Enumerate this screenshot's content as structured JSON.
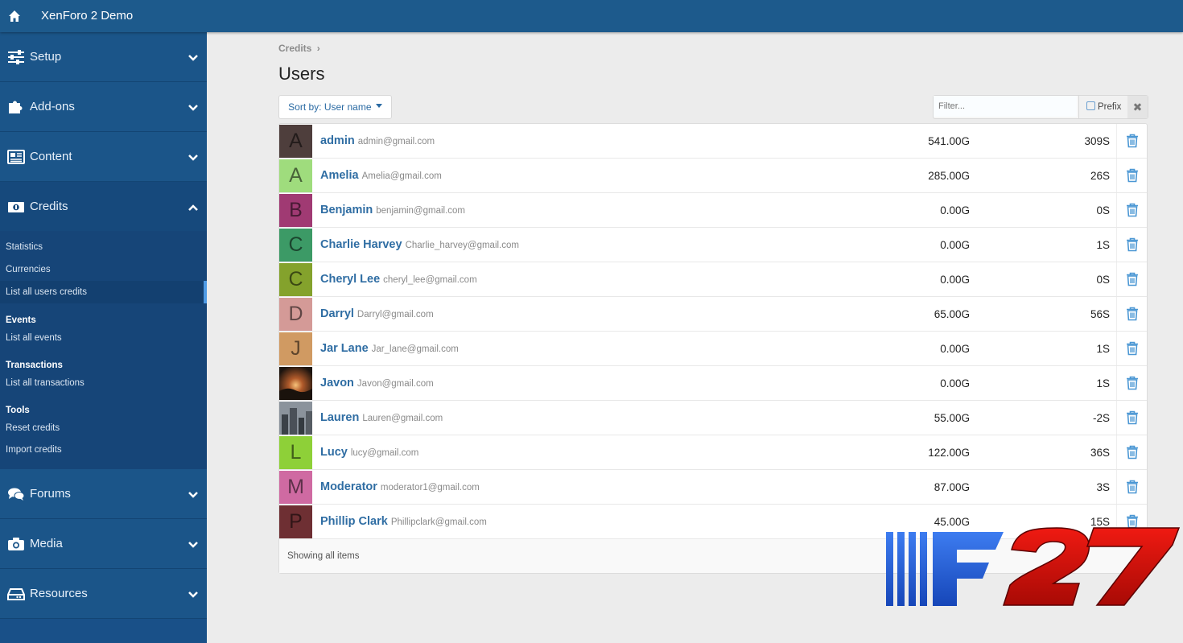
{
  "app": {
    "title": "XenForo 2 Demo"
  },
  "sidebar": {
    "top_sections": [
      {
        "label": "Setup",
        "icon": "sliders-icon"
      },
      {
        "label": "Add-ons",
        "icon": "puzzle-icon"
      },
      {
        "label": "Content",
        "icon": "newspaper-icon"
      }
    ],
    "credits": {
      "label": "Credits",
      "icon": "money-icon",
      "items": [
        "Statistics",
        "Currencies",
        "List all users credits"
      ],
      "groups": [
        {
          "heading": "Events",
          "items": [
            "List all events"
          ]
        },
        {
          "heading": "Transactions",
          "items": [
            "List all transactions"
          ]
        },
        {
          "heading": "Tools",
          "items": [
            "Reset credits",
            "Import credits"
          ]
        }
      ]
    },
    "bottom_sections": [
      {
        "label": "Forums",
        "icon": "comments-icon"
      },
      {
        "label": "Media",
        "icon": "camera-icon"
      },
      {
        "label": "Resources",
        "icon": "drive-icon"
      }
    ]
  },
  "page": {
    "breadcrumb": "Credits",
    "breadcrumb_sep": "›",
    "title": "Users",
    "sort_label": "Sort by: User name",
    "filter_placeholder": "Filter...",
    "prefix_label": "Prefix",
    "clear_glyph": "✖",
    "footer": "Showing all items"
  },
  "users": [
    {
      "initial": "A",
      "color": "#4e3e3c",
      "name": "admin",
      "email": "admin@gmail.com",
      "credit1": "541.00G",
      "credit2": "309S"
    },
    {
      "initial": "A",
      "color": "#9fdc7d",
      "name": "Amelia",
      "email": "Amelia@gmail.com",
      "credit1": "285.00G",
      "credit2": "26S"
    },
    {
      "initial": "B",
      "color": "#a03a73",
      "name": "Benjamin",
      "email": "benjamin@gmail.com",
      "credit1": "0.00G",
      "credit2": "0S"
    },
    {
      "initial": "C",
      "color": "#3c9a66",
      "name": "Charlie Harvey",
      "email": "Charlie_harvey@gmail.com",
      "credit1": "0.00G",
      "credit2": "1S"
    },
    {
      "initial": "C",
      "color": "#84a22c",
      "name": "Cheryl Lee",
      "email": "cheryl_lee@gmail.com",
      "credit1": "0.00G",
      "credit2": "0S"
    },
    {
      "initial": "D",
      "color": "#d49a97",
      "name": "Darryl",
      "email": "Darryl@gmail.com",
      "credit1": "65.00G",
      "credit2": "56S"
    },
    {
      "initial": "J",
      "color": "#d09a62",
      "name": "Jar Lane",
      "email": "Jar_lane@gmail.com",
      "credit1": "0.00G",
      "credit2": "1S"
    },
    {
      "initial": "",
      "color": "#3a2a22",
      "photo": "sunset",
      "name": "Javon",
      "email": "Javon@gmail.com",
      "credit1": "0.00G",
      "credit2": "1S"
    },
    {
      "initial": "",
      "color": "#50565e",
      "photo": "city",
      "name": "Lauren",
      "email": "Lauren@gmail.com",
      "credit1": "55.00G",
      "credit2": "-2S"
    },
    {
      "initial": "L",
      "color": "#8ed038",
      "name": "Lucy",
      "email": "lucy@gmail.com",
      "credit1": "122.00G",
      "credit2": "36S"
    },
    {
      "initial": "M",
      "color": "#cf6aa2",
      "name": "Moderator",
      "email": "moderator1@gmail.com",
      "credit1": "87.00G",
      "credit2": "3S"
    },
    {
      "initial": "P",
      "color": "#6e2f33",
      "name": "Phillip Clark",
      "email": "Phillipclark@gmail.com",
      "credit1": "45.00G",
      "credit2": "15S"
    }
  ],
  "colors": {
    "header": "#1d5a8c",
    "sidebar": "#195088",
    "link": "#2f6da3",
    "accent": "#4e9be6"
  }
}
